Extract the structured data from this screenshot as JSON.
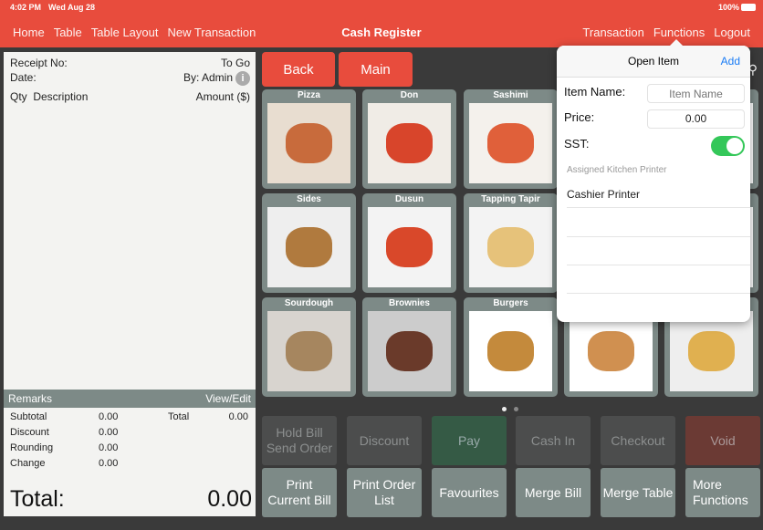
{
  "status": {
    "time": "4:02 PM",
    "date": "Wed Aug 28",
    "battery": "100%"
  },
  "nav": {
    "left": [
      "Home",
      "Table",
      "Table Layout",
      "New Transaction"
    ],
    "title": "Cash Register",
    "right": [
      "Transaction",
      "Functions",
      "Logout"
    ]
  },
  "receipt": {
    "receipt_no_label": "Receipt No:",
    "order_type": "To Go",
    "date_label": "Date:",
    "by": "By: Admin",
    "qty": "Qty",
    "description": "Description",
    "amount": "Amount ($)",
    "remarks": "Remarks",
    "view_edit": "View/Edit",
    "subtotal_label": "Subtotal",
    "subtotal": "0.00",
    "discount_label": "Discount",
    "discount": "0.00",
    "rounding_label": "Rounding",
    "rounding": "0.00",
    "change_label": "Change",
    "change": "0.00",
    "total_label": "Total",
    "total": "0.00",
    "grand_total_label": "Total:",
    "grand_total": "0.00"
  },
  "buttons": {
    "back": "Back",
    "main": "Main"
  },
  "categories": [
    "Pizza",
    "Don",
    "Sashimi",
    "",
    "",
    "Sides",
    "Dusun",
    "Tapping Tapir",
    "",
    "",
    "Sourdough",
    "Brownies",
    "Burgers",
    "",
    ""
  ],
  "page_dots": {
    "count": 2,
    "active": 1
  },
  "functions_row1": [
    "Hold Bill\nSend Order",
    "Discount",
    "Pay",
    "Cash In",
    "Checkout",
    "Void"
  ],
  "functions_row2": [
    "Print\nCurrent Bill",
    "Print Order\nList",
    "Favourites",
    "Merge Bill",
    "Merge Table",
    "More\nFunctions"
  ],
  "popup": {
    "title": "Open Item",
    "add": "Add",
    "item_name_label": "Item Name:",
    "item_name_placeholder": "Item Name",
    "price_label": "Price:",
    "price_value": "0.00",
    "sst_label": "SST:",
    "sst_on": true,
    "printer_header": "Assigned Kitchen Printer",
    "printers": [
      "Cashier Printer"
    ]
  },
  "colors": {
    "accent": "#e84c3d",
    "pay": "#355a45",
    "void": "#6b3a34",
    "tile": "#7d8a87",
    "toggle": "#34c759",
    "link": "#1a7cf5"
  }
}
